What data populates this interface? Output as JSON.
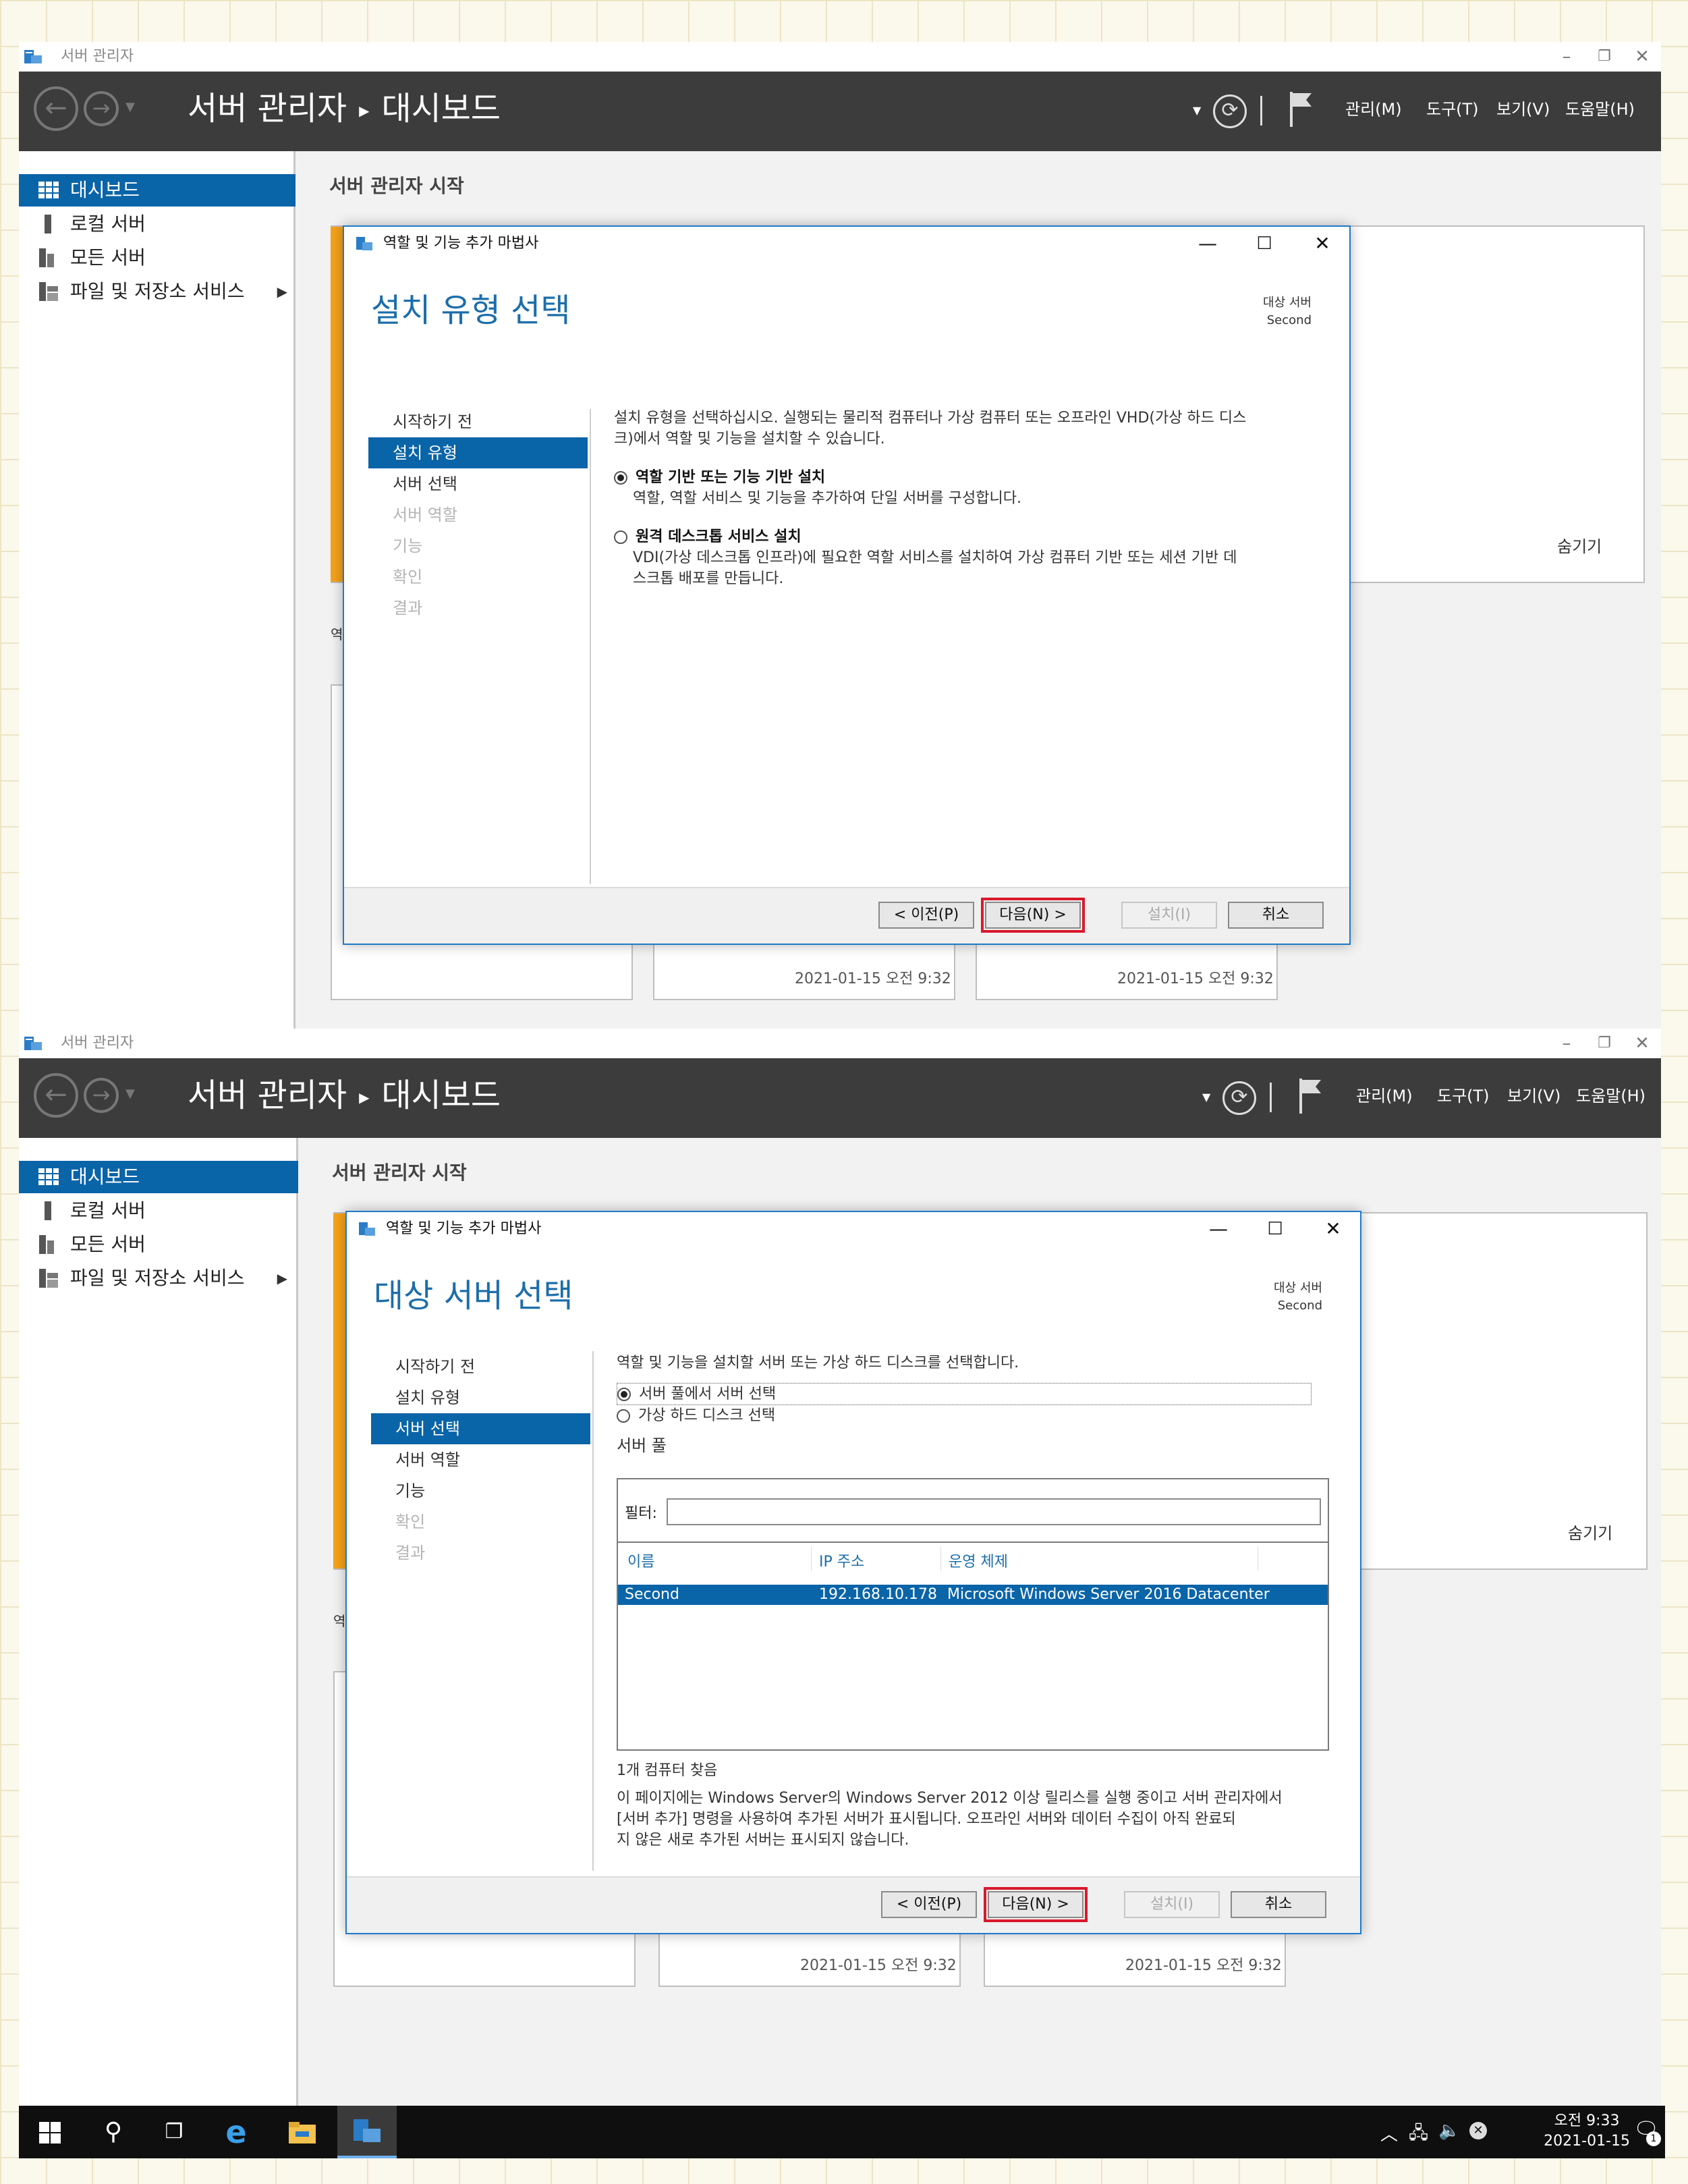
{
  "window": {
    "title": "서버 관리자",
    "header_title": "서버 관리자",
    "header_page": "대시보드",
    "menu": [
      "관리(M)",
      "도구(T)",
      "보기(V)",
      "도움말(H)"
    ]
  },
  "sidebar": {
    "items": [
      {
        "label": "대시보드",
        "icon": "dashboard-icon"
      },
      {
        "label": "로컬 서버",
        "icon": "local-server-icon"
      },
      {
        "label": "모든 서버",
        "icon": "all-servers-icon"
      },
      {
        "label": "파일 및 저장소 서비스",
        "icon": "storage-icon"
      }
    ]
  },
  "main": {
    "title": "서버 관리자 시작",
    "hide": "숨기기",
    "tile_dates": [
      "2021-01-15 오전 9:32",
      "2021-01-15 오전 9:32"
    ],
    "snippet": "역"
  },
  "dialog1": {
    "title": "역할 및 기능 추가 마법사",
    "heading": "설치 유형 선택",
    "target_label": "대상 서버",
    "target_value": "Second",
    "steps": [
      "시작하기 전",
      "설치 유형",
      "서버 선택",
      "서버 역할",
      "기능",
      "확인",
      "결과"
    ],
    "intro_line1": "설치 유형을 선택하십시오. 실행되는 물리적 컴퓨터나 가상 컴퓨터 또는 오프라인 VHD(가상 하드 디스",
    "intro_line2": "크)에서 역할 및 기능을 설치할 수 있습니다.",
    "option1_title": "역할 기반 또는 기능 기반 설치",
    "option1_desc": "역할, 역할 서비스 및 기능을 추가하여 단일 서버를 구성합니다.",
    "option2_title": "원격 데스크톱 서비스 설치",
    "option2_desc1": "VDI(가상 데스크톱 인프라)에 필요한 역할 서비스를 설치하여 가상 컴퓨터 기반 또는 세션 기반 데",
    "option2_desc2": "스크톱 배포를 만듭니다.",
    "btn_prev": "< 이전(P)",
    "btn_next": "다음(N) >",
    "btn_install": "설치(I)",
    "btn_cancel": "취소"
  },
  "dialog2": {
    "title": "역할 및 기능 추가 마법사",
    "heading": "대상 서버 선택",
    "target_label": "대상 서버",
    "target_value": "Second",
    "steps": [
      "시작하기 전",
      "설치 유형",
      "서버 선택",
      "서버 역할",
      "기능",
      "확인",
      "결과"
    ],
    "intro": "역할 및 기능을 설치할 서버 또는 가상 하드 디스크를 선택합니다.",
    "radio1": "서버 풀에서 서버 선택",
    "radio2": "가상 하드 디스크 선택",
    "pool_label": "서버 풀",
    "filter_label": "필터:",
    "filter_value": "",
    "columns": [
      "이름",
      "IP 주소",
      "운영 체제"
    ],
    "rows": [
      {
        "name": "Second",
        "ip": "192.168.10.178",
        "os": "Microsoft Windows Server 2016 Datacenter"
      }
    ],
    "found": "1개 컴퓨터 찾음",
    "note1": "이 페이지에는 Windows Server의 Windows Server 2012 이상 릴리스를 실행 중이고 서버 관리자에서",
    "note2": "[서버 추가] 명령을 사용하여 추가된 서버가 표시됩니다. 오프라인 서버와 데이터 수집이 아직 완료되",
    "note3": "지 않은 새로 추가된 서버는 표시되지 않습니다.",
    "btn_prev": "< 이전(P)",
    "btn_next": "다음(N) >",
    "btn_install": "설치(I)",
    "btn_cancel": "취소"
  },
  "taskbar": {
    "time": "오전 9:33",
    "date": "2021-01-15",
    "notification_count": "1"
  },
  "colors": {
    "accent": "#0a64a8",
    "header": "#3c3c3c",
    "highlight": "#d9192c",
    "tile_accent": "#f6a21a"
  }
}
